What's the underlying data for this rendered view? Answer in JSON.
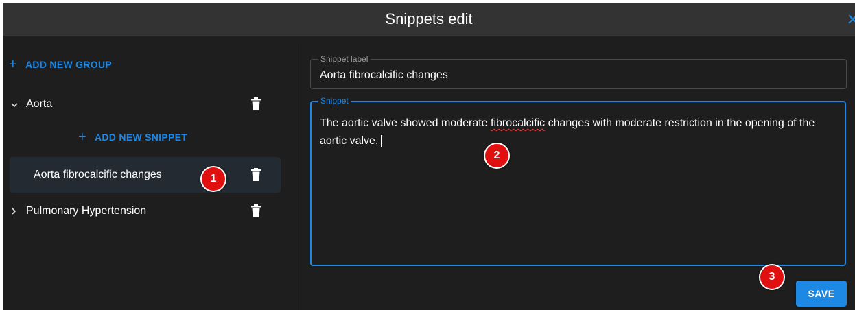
{
  "dialog": {
    "title": "Snippets edit"
  },
  "sidebar": {
    "add_group_label": "ADD NEW GROUP",
    "add_snippet_label": "ADD NEW SNIPPET",
    "groups": [
      {
        "label": "Aorta",
        "expanded": true,
        "expand_icon": "chevron-down-icon"
      },
      {
        "label": "Pulmonary Hypertension",
        "expanded": false,
        "expand_icon": "chevron-right-icon"
      }
    ],
    "snippets": [
      {
        "label": "Aorta fibrocalcific changes",
        "selected": true
      }
    ]
  },
  "editor": {
    "label_field": {
      "legend": "Snippet label",
      "value": "Aorta fibrocalcific changes"
    },
    "snippet_field": {
      "legend": "Snippet",
      "text_before": "The aortic valve showed moderate ",
      "misspelled": "fibrocalcific",
      "text_after": " changes with moderate restriction in the opening of the aortic valve."
    },
    "save_label": "SAVE"
  },
  "annotations": [
    "1",
    "2",
    "3"
  ],
  "colors": {
    "accent": "#1e88e5",
    "background": "#1e1e1e",
    "titlebar": "#333333",
    "badge": "#e01010"
  }
}
